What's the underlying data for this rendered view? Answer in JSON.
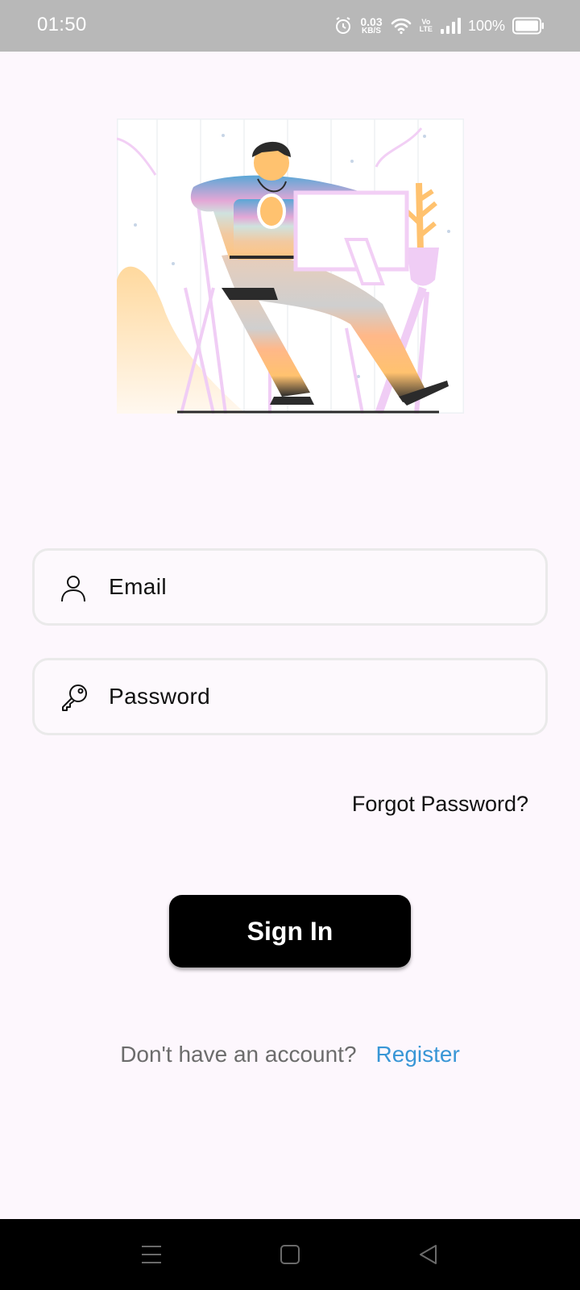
{
  "status_bar": {
    "time": "01:50",
    "net_speed_value": "0.03",
    "net_speed_unit": "KB/S",
    "volte_top": "Vo",
    "volte_bottom": "LTE",
    "battery_percent": "100%",
    "icons": [
      "alarm-icon",
      "wifi-icon",
      "signal-icon",
      "battery-icon"
    ]
  },
  "illustration": {
    "icon": "person-with-laptop-illustration"
  },
  "form": {
    "email_placeholder": "Email",
    "password_placeholder": "Password",
    "email_icon": "person-icon",
    "password_icon": "key-icon",
    "forgot_label": "Forgot Password?",
    "signin_label": "Sign In",
    "register_prompt": "Don't have an account?",
    "register_label": "Register"
  },
  "colors": {
    "background": "#fdf7fd",
    "button": "#000000",
    "link": "#3896d6",
    "status_bar": "#b8b8b8"
  },
  "nav_bar": {
    "icons": [
      "menu-icon",
      "home-square-icon",
      "back-triangle-icon"
    ]
  }
}
